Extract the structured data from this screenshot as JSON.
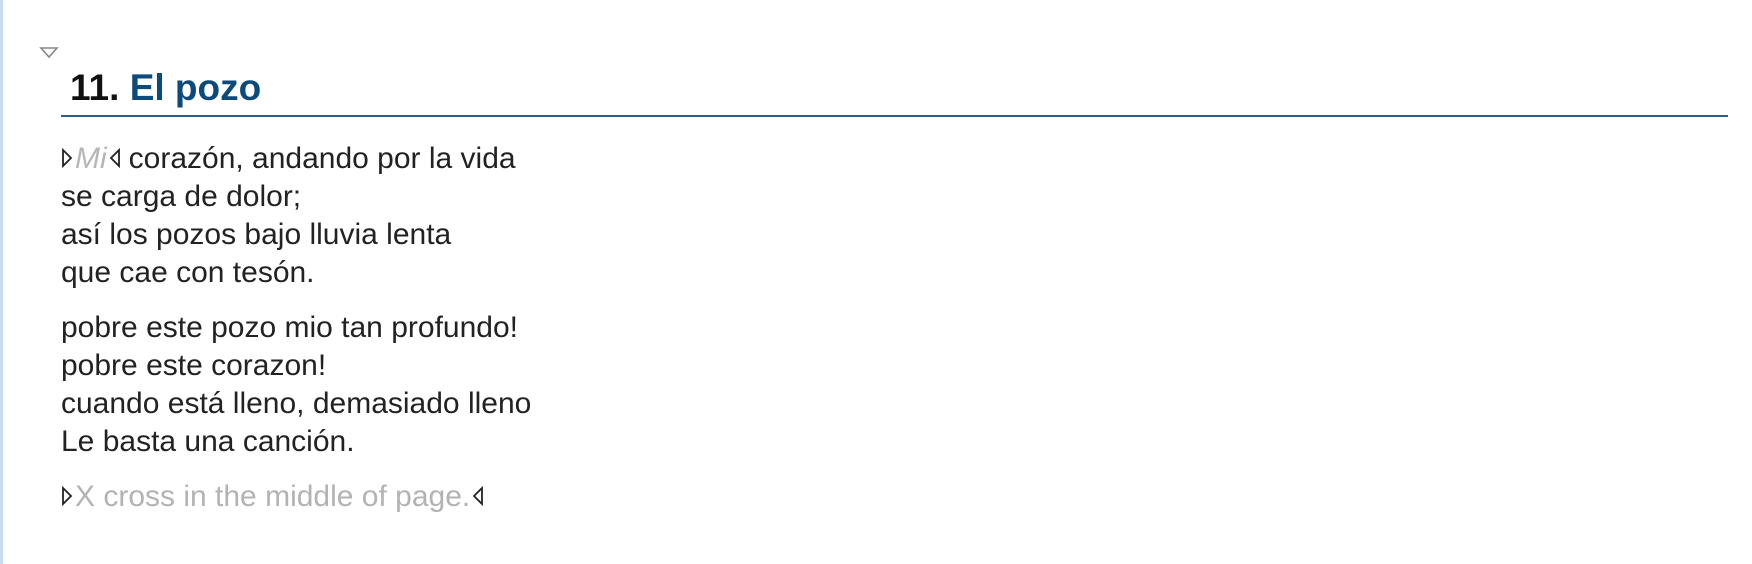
{
  "song": {
    "number": "11.",
    "title": "El pozo"
  },
  "verses": [
    {
      "lines": [
        {
          "chord": "Mi",
          "text": "corazón, andando por la vida"
        },
        {
          "text": "se carga de dolor;"
        },
        {
          "text": "así los pozos bajo lluvia lenta"
        },
        {
          "text": "que cae con tesón."
        }
      ]
    },
    {
      "lines": [
        {
          "text": "pobre este pozo mio tan profundo!"
        },
        {
          "text": "pobre este corazon!"
        },
        {
          "text": "cuando está lleno, demasiado lleno"
        },
        {
          "text": "Le basta una canción."
        }
      ]
    }
  ],
  "note": {
    "text": "X cross in the middle of page."
  },
  "icons": {
    "collapse": "triangle-down-icon",
    "marker_start": "triangle-right-icon",
    "marker_end": "triangle-left-icon"
  },
  "colors": {
    "title": "#0d4a7c",
    "rule": "#2c5d86",
    "left_border": "#c8dcef",
    "chord": "#b6b6b6",
    "note": "#b3b3b3"
  }
}
